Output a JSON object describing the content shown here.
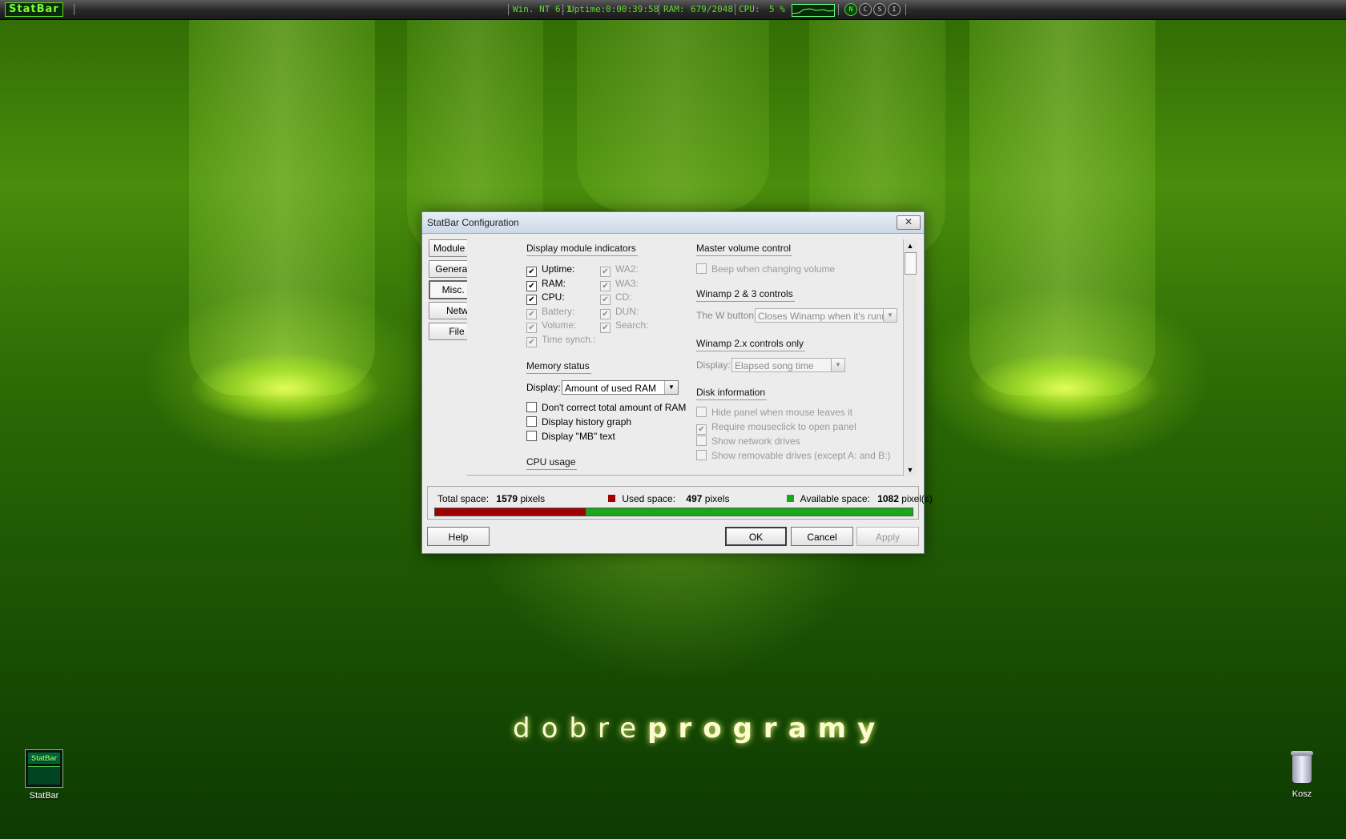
{
  "topbar": {
    "logo": "StatBar",
    "os": "Win. NT 6.1",
    "uptime_label": "Uptime:",
    "uptime_value": "0:00:39:58",
    "ram_label": "RAM:",
    "ram_value": "679/2048",
    "cpu_label": "CPU:",
    "cpu_value": "5 %",
    "buttons": [
      "N",
      "C",
      "S",
      "I"
    ]
  },
  "brand": {
    "light": "dobre",
    "bold": "programy"
  },
  "desktop": {
    "statbar_icon_label": "StatBar",
    "trash_label": "Kosz"
  },
  "dialog": {
    "title": "StatBar Configuration",
    "close_glyph": "✕",
    "nav": [
      "Module Selection",
      "General Options",
      "Misc. Options",
      "Networking",
      "File Paths"
    ],
    "active_nav": "Misc. Options",
    "display_indicators": {
      "heading": "Display module indicators",
      "left": [
        {
          "label": "Uptime:",
          "checked": true,
          "enabled": true
        },
        {
          "label": "RAM:",
          "checked": true,
          "enabled": true
        },
        {
          "label": "CPU:",
          "checked": true,
          "enabled": true
        },
        {
          "label": "Battery:",
          "checked": true,
          "enabled": false
        },
        {
          "label": "Volume:",
          "checked": true,
          "enabled": false
        },
        {
          "label": "Time synch.:",
          "checked": true,
          "enabled": false
        }
      ],
      "right": [
        {
          "label": "WA2:",
          "checked": true,
          "enabled": false
        },
        {
          "label": "WA3:",
          "checked": true,
          "enabled": false
        },
        {
          "label": "CD:",
          "checked": true,
          "enabled": false
        },
        {
          "label": "DUN:",
          "checked": true,
          "enabled": false
        },
        {
          "label": "Search:",
          "checked": true,
          "enabled": false
        }
      ]
    },
    "memory": {
      "heading": "Memory status",
      "display_label": "Display:",
      "display_value": "Amount of used RAM",
      "options": [
        {
          "label": "Don't correct total amount of RAM",
          "checked": false
        },
        {
          "label": "Display history graph",
          "checked": false
        },
        {
          "label": "Display \"MB\" text",
          "checked": false
        }
      ]
    },
    "cpu_heading": "CPU usage",
    "master_volume": {
      "heading": "Master volume control",
      "beep_label": "Beep when changing volume",
      "beep_checked": false
    },
    "winamp23": {
      "heading": "Winamp 2 & 3 controls",
      "w_label": "The W button:",
      "w_value": "Closes Winamp when it's running"
    },
    "winamp2x": {
      "heading": "Winamp 2.x controls only",
      "display_label": "Display:",
      "display_value": "Elapsed song time"
    },
    "disk": {
      "heading": "Disk information",
      "options": [
        {
          "label": "Hide panel when mouse leaves it",
          "checked": false
        },
        {
          "label": "Require mouseclick to open panel",
          "checked": true
        },
        {
          "label": "Show network drives",
          "checked": false
        },
        {
          "label": "Show removable drives (except A: and B:)",
          "checked": false
        }
      ]
    },
    "space": {
      "total_label": "Total space:",
      "total_value": "1579",
      "total_unit": "pixels",
      "used_label": "Used space:",
      "used_value": "497",
      "used_unit": "pixels",
      "avail_label": "Available space:",
      "avail_value": "1082",
      "avail_unit": "pixel(s)",
      "used_fraction": 0.3148,
      "used_color": "#a00000",
      "avail_color": "#1aa81a"
    },
    "buttons": {
      "help": "Help",
      "ok": "OK",
      "cancel": "Cancel",
      "apply": "Apply"
    }
  }
}
